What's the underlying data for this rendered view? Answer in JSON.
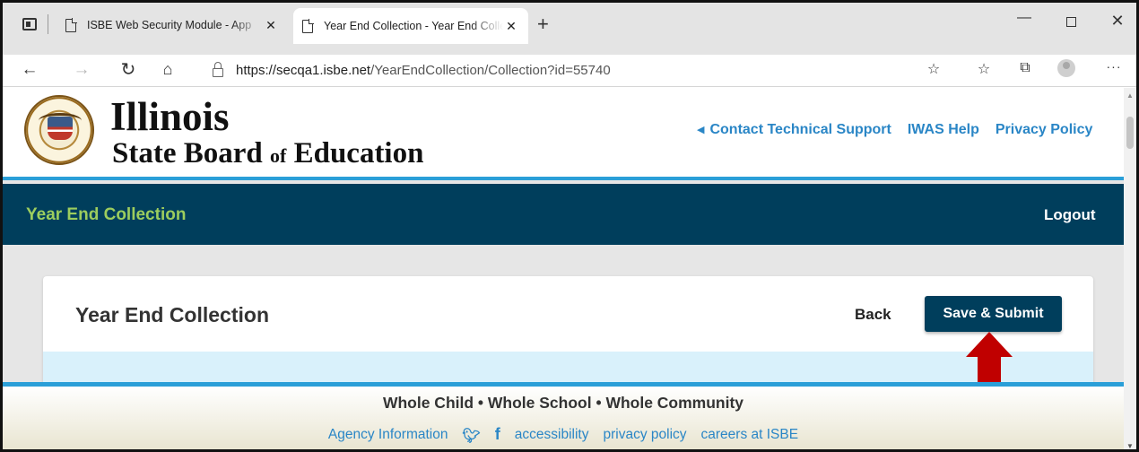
{
  "browser": {
    "tabs": [
      {
        "title": "ISBE Web Security Module - App",
        "close": "✕"
      },
      {
        "title": "Year End Collection - Year End Collection",
        "close": "✕"
      }
    ],
    "new_tab": "+",
    "url": {
      "host": "https://secqa1.isbe.net",
      "path": "/YearEndCollection/Collection?id=55740"
    }
  },
  "header": {
    "logo_line1": "Illinois",
    "logo_line2_a": "State Board",
    "logo_line2_of": "of",
    "logo_line2_b": "Education",
    "links": [
      "Contact Technical Support",
      "IWAS Help",
      "Privacy Policy"
    ]
  },
  "app_bar": {
    "title": "Year End Collection",
    "logout": "Logout"
  },
  "card": {
    "title": "Year End Collection",
    "back": "Back",
    "save_submit": "Save & Submit"
  },
  "footer": {
    "tagline": "Whole Child • Whole School • Whole Community",
    "links": [
      "Agency Information",
      "accessibility",
      "privacy policy",
      "careers at ISBE"
    ]
  },
  "icons": {
    "tab_actions": "tab-actions-icon",
    "page": "page-icon",
    "back": "back-arrow-icon",
    "forward": "forward-arrow-icon",
    "refresh": "refresh-icon",
    "home": "home-icon",
    "lock": "lock-icon",
    "favorite_add": "favorite-add-icon",
    "favorites": "favorites-icon",
    "collections": "collections-icon",
    "profile": "profile-icon",
    "more": "more-icon",
    "twitter": "twitter-icon",
    "facebook": "facebook-icon"
  },
  "colors": {
    "navy": "#003e5c",
    "accent_blue": "#2a9fd8",
    "link_blue": "#2a86c6",
    "title_green": "#9ccd5e",
    "arrow_red": "#c00000",
    "strip": "#d9f1fb"
  }
}
